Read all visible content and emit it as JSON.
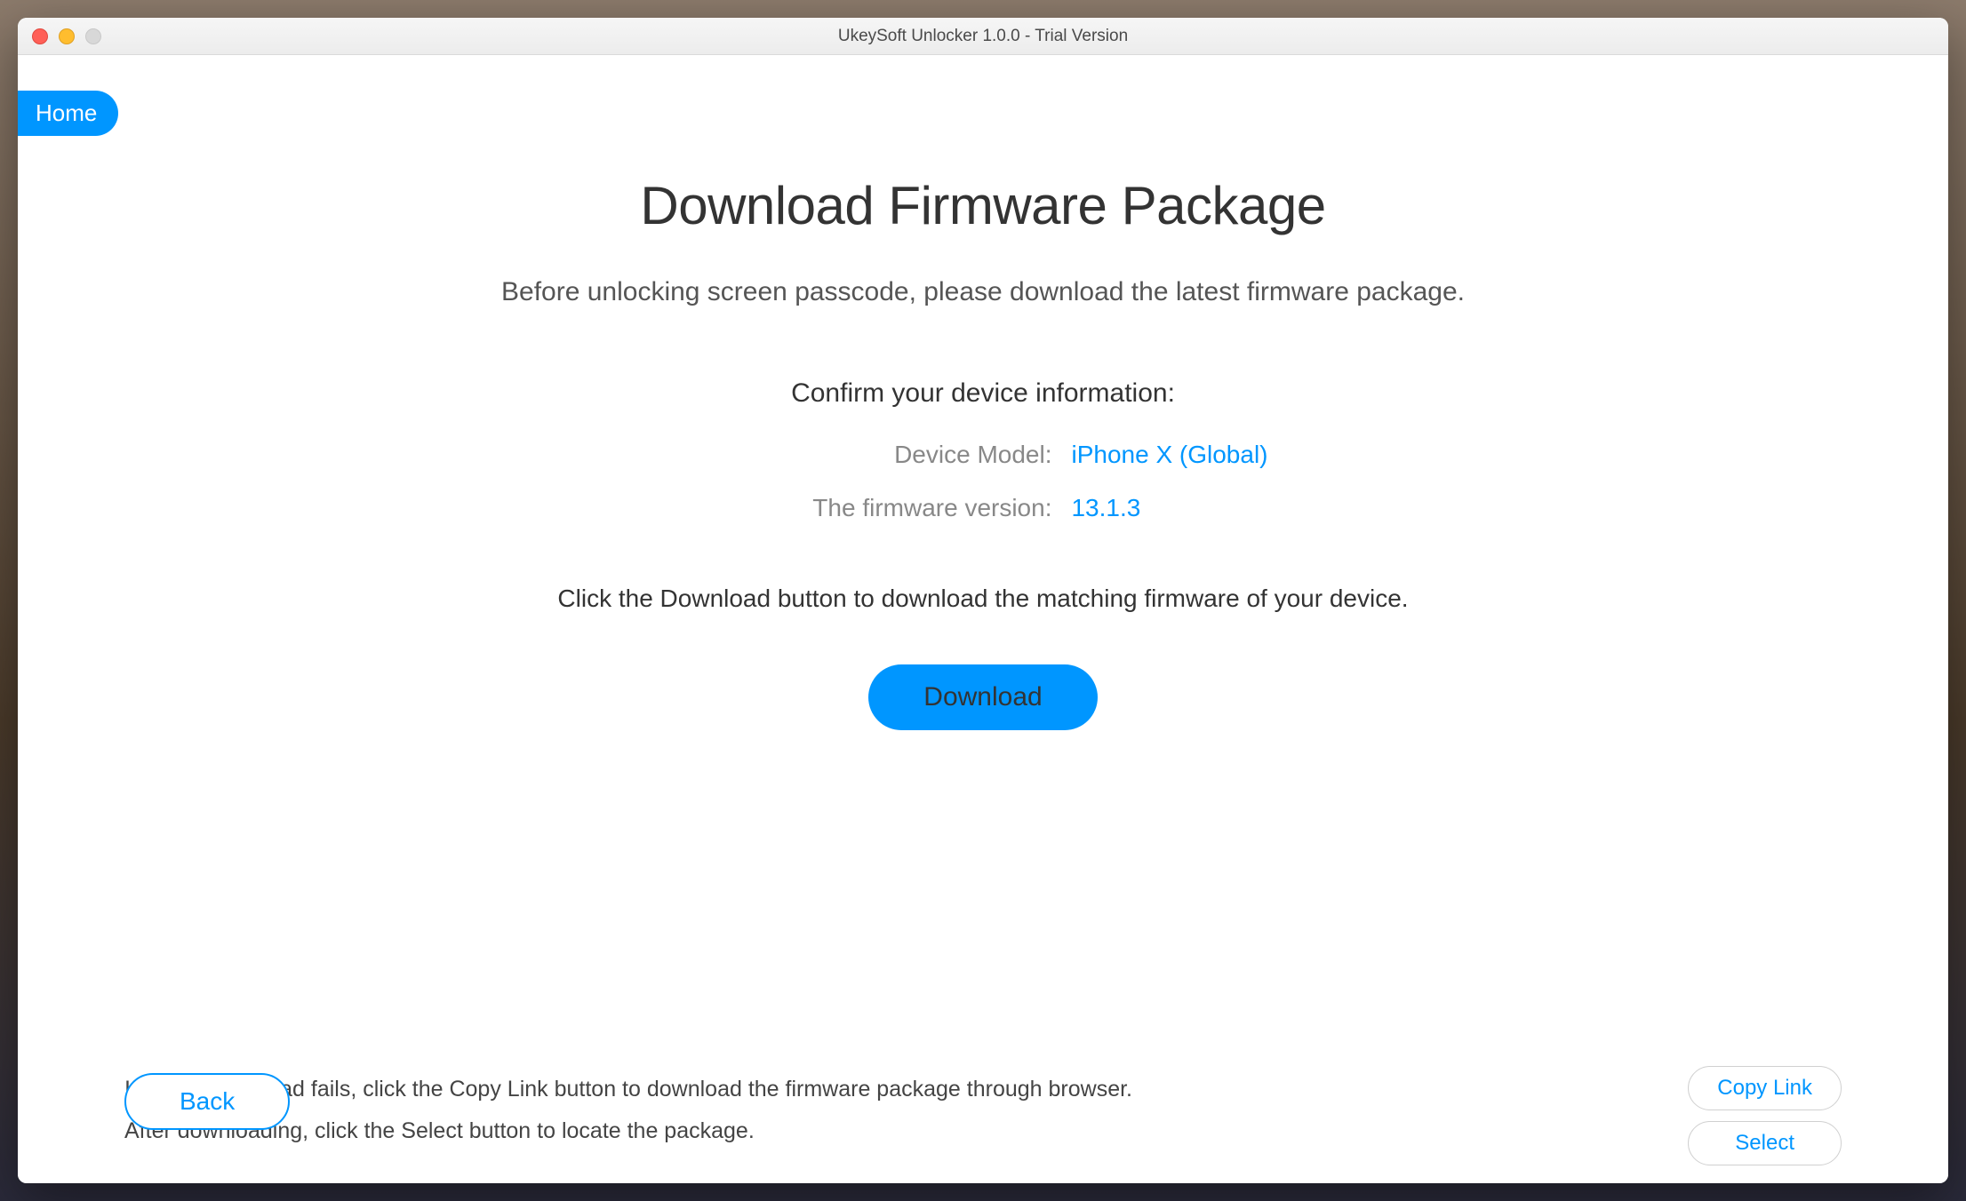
{
  "window": {
    "title": "UkeySoft Unlocker 1.0.0 - Trial Version"
  },
  "nav": {
    "home_label": "Home"
  },
  "page": {
    "title": "Download Firmware Package",
    "subtitle": "Before unlocking screen passcode, please download the latest firmware package.",
    "confirm_heading": "Confirm your device information:",
    "device_model_label": "Device Model:",
    "device_model_value": "iPhone X (Global)",
    "firmware_version_label": "The firmware version:",
    "firmware_version_value": "13.1.3",
    "download_instruction": "Click the Download button to download the matching firmware of your device.",
    "download_button_label": "Download"
  },
  "footer": {
    "fail_text": "If above download fails, click the Copy Link button to download the firmware package through browser.",
    "after_download_text": "After downloading, click the Select button to locate the package.",
    "copy_link_label": "Copy Link",
    "select_label": "Select",
    "back_label": "Back"
  },
  "colors": {
    "accent": "#0096ff"
  }
}
